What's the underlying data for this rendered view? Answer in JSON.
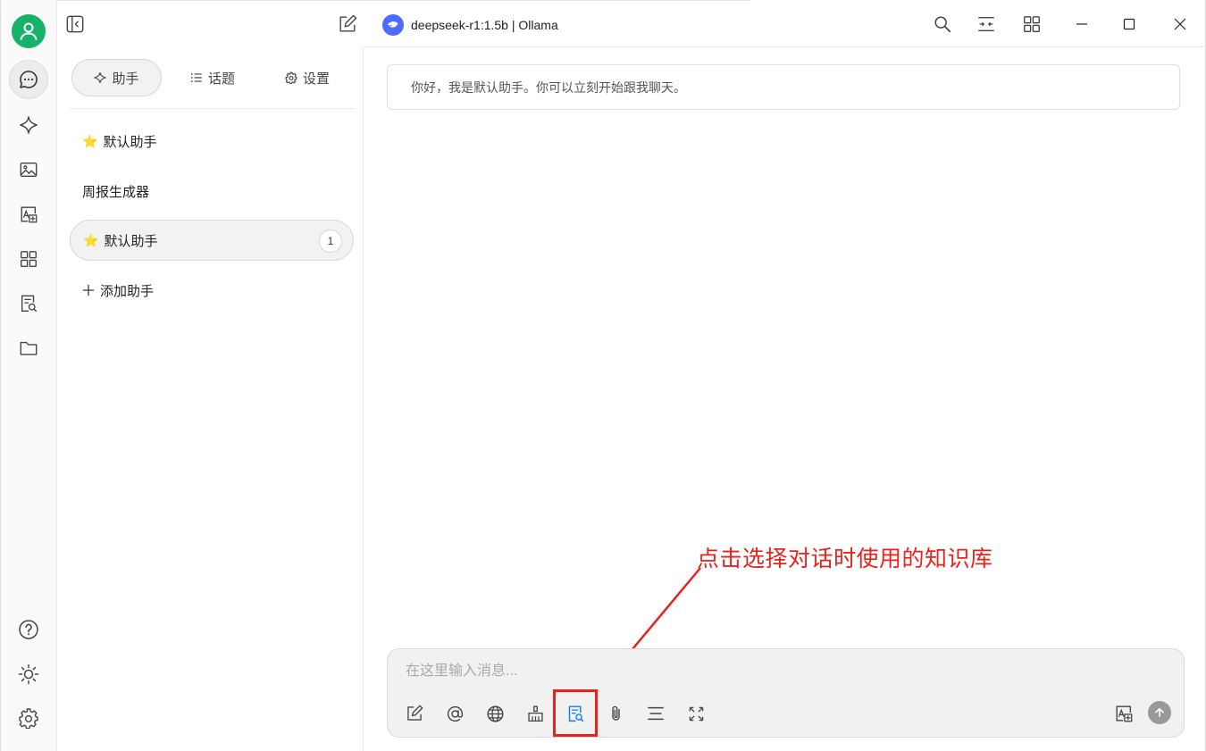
{
  "window": {
    "model_title": "deepseek-r1:1.5b | Ollama"
  },
  "assistants_panel": {
    "tabs": [
      {
        "label": "助手",
        "icon": "sparkle-icon"
      },
      {
        "label": "话题",
        "icon": "list-icon"
      },
      {
        "label": "设置",
        "icon": "gear-icon"
      }
    ],
    "items": [
      {
        "label": "默认助手",
        "emoji": "⭐"
      },
      {
        "label": "周报生成器",
        "emoji": ""
      },
      {
        "label": "默认助手",
        "emoji": "⭐",
        "count": "1"
      }
    ],
    "add_label": "添加助手"
  },
  "chat": {
    "welcome_message": "你好，我是默认助手。你可以立刻开始跟我聊天。",
    "input_placeholder": "在这里输入消息..."
  },
  "annotation": {
    "text": "点击选择对话时使用的知识库"
  },
  "colors": {
    "accent_green": "#17b26a",
    "annotation_red": "#e8231d",
    "model_logo": "#4d6bfe",
    "knowledge_icon": "#1677ff"
  }
}
